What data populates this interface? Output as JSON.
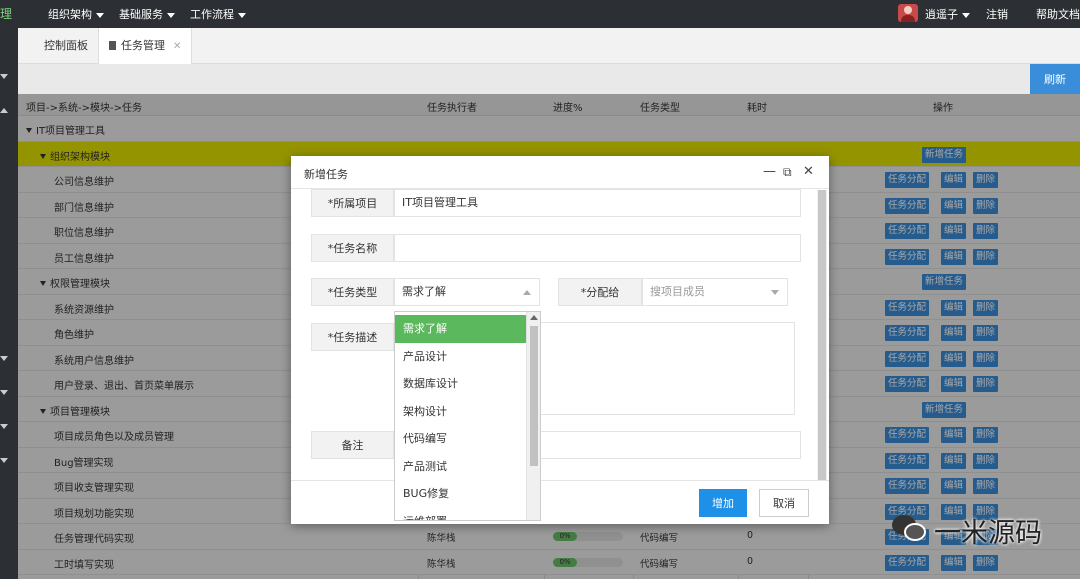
{
  "topbar": {
    "menus": [
      "组织架构",
      "基础服务",
      "工作流程"
    ],
    "user": "逍遥子",
    "logout": "注销",
    "help": "帮助文档"
  },
  "tabs": [
    {
      "label": "控制面板"
    },
    {
      "label": "任务管理"
    }
  ],
  "toolbar": {
    "refresh": "刷新"
  },
  "grid": {
    "headers": [
      "项目->系统->模块->任务",
      "任务执行者",
      "进度%",
      "任务类型",
      "耗时",
      "操作"
    ],
    "rows": [
      {
        "name": "IT项目管理工具",
        "level": 0,
        "toggle": true
      },
      {
        "name": "组织架构模块",
        "level": 1,
        "toggle": true,
        "highlight": true,
        "action": "新增任务"
      },
      {
        "name": "公司信息维护",
        "level": 2
      },
      {
        "name": "部门信息维护",
        "level": 2
      },
      {
        "name": "职位信息维护",
        "level": 2
      },
      {
        "name": "员工信息维护",
        "level": 2
      },
      {
        "name": "权限管理模块",
        "level": 1,
        "toggle": true,
        "action": "新增任务"
      },
      {
        "name": "系统资源维护",
        "level": 2
      },
      {
        "name": "角色维护",
        "level": 2
      },
      {
        "name": "系统用户信息维护",
        "level": 2
      },
      {
        "name": "用户登录、退出、首页菜单展示",
        "level": 2
      },
      {
        "name": "项目管理模块",
        "level": 1,
        "toggle": true,
        "action": "新增任务"
      },
      {
        "name": "项目成员角色以及成员管理",
        "level": 2
      },
      {
        "name": "Bug管理实现",
        "level": 2
      },
      {
        "name": "项目收支管理实现",
        "level": 2
      },
      {
        "name": "项目规划功能实现",
        "level": 2
      },
      {
        "name": "任务管理代码实现",
        "level": 2,
        "executor": "陈华栈",
        "progress": "0%",
        "type": "代码编写",
        "time": "0"
      },
      {
        "name": "工时填写实现",
        "level": 2,
        "executor": "陈华栈",
        "progress": "0%",
        "type": "代码编写",
        "time": "0"
      }
    ],
    "task_actions": [
      "任务分配",
      "编辑",
      "删除"
    ]
  },
  "modal": {
    "title": "新增任务",
    "project_label": "*所属项目",
    "project_value": "IT项目管理工具",
    "name_label": "*任务名称",
    "name_value": "",
    "type_label": "*任务类型",
    "type_value": "需求了解",
    "assign_label": "*分配给",
    "assign_placeholder": "搜项目成员",
    "desc_label": "*任务描述",
    "note_label": "备注",
    "add_button": "增加",
    "cancel_button": "取消",
    "type_options": [
      "需求了解",
      "产品设计",
      "数据库设计",
      "架构设计",
      "代码编写",
      "产品测试",
      "BUG修复",
      "运维部署"
    ]
  },
  "watermark": {
    "text": "一米源码"
  }
}
